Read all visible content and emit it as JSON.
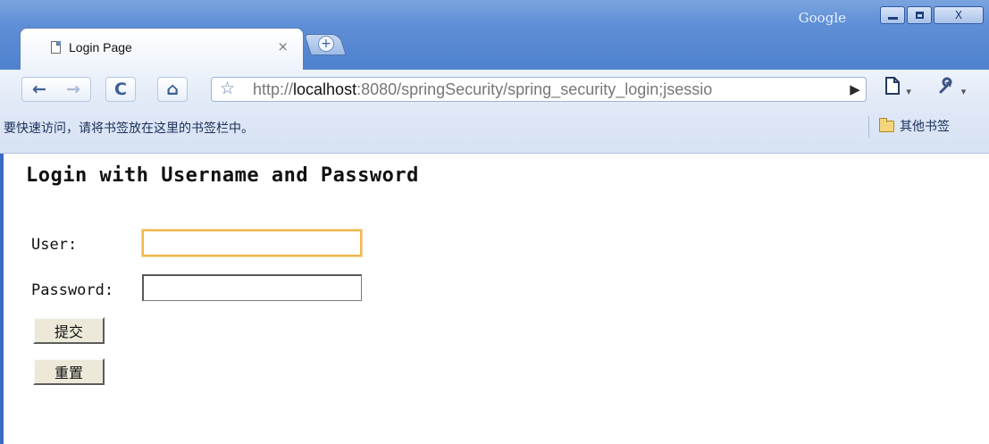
{
  "window": {
    "brand": "Google",
    "controls": {
      "minimize": "–",
      "maximize": "□",
      "close": "X"
    }
  },
  "tab": {
    "title": "Login Page",
    "close": "×",
    "new_tab": "+"
  },
  "toolbar": {
    "back": "←",
    "forward": "→",
    "reload": "C",
    "home": "⌂",
    "star": "☆",
    "url_prefix": "http://",
    "url_host": "localhost",
    "url_rest": ":8080/springSecurity/spring_security_login;jsessio",
    "go": "▶",
    "page_menu": "🗋",
    "wrench_menu": "🔧",
    "caret": "▾"
  },
  "bookmarks": {
    "hint": "要快速访问，请将书签放在这里的书签栏中。",
    "other": "其他书签"
  },
  "page": {
    "heading": "Login with Username and Password",
    "user_label": "User:",
    "user_value": "",
    "password_label": "Password:",
    "password_value": "",
    "submit_label": "提交",
    "reset_label": "重置"
  }
}
